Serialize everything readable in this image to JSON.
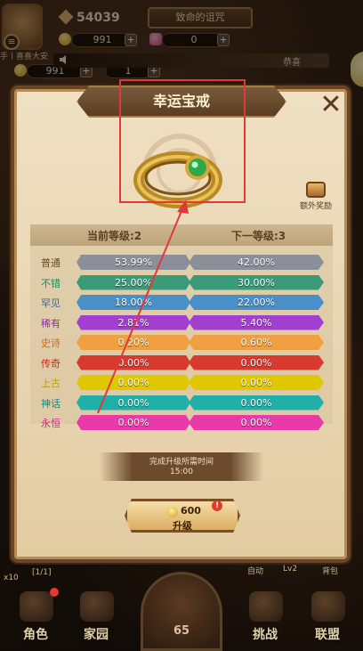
{
  "hud": {
    "power": "54039",
    "title_tab": "致命的诅咒",
    "gold": "991",
    "gem": "0",
    "gold2": "991",
    "slot": "1",
    "sub_label": "恭喜",
    "left_text": "手丨喜喜大安"
  },
  "panel": {
    "title": "幸运宝戒",
    "close_symbol": "✕",
    "extra_label": "额外奖励"
  },
  "table": {
    "current_header": "当前等级:2",
    "next_header": "下一等级:3",
    "rows": [
      {
        "label": "普通",
        "cur": "53.99%",
        "next": "42.00%",
        "label_color": "#6a4a2a",
        "color": "#8a8f98"
      },
      {
        "label": "不错",
        "cur": "25.00%",
        "next": "30.00%",
        "label_color": "#1f8a5a",
        "color": "#3b9a78"
      },
      {
        "label": "罕见",
        "cur": "18.00%",
        "next": "22.00%",
        "label_color": "#2a6aa8",
        "color": "#4a8fc8"
      },
      {
        "label": "稀有",
        "cur": "2.81%",
        "next": "5.40%",
        "label_color": "#8a2ab8",
        "color": "#a23fd0"
      },
      {
        "label": "史诗",
        "cur": "0.20%",
        "next": "0.60%",
        "label_color": "#d86a10",
        "color": "#f0a040"
      },
      {
        "label": "传奇",
        "cur": "0.00%",
        "next": "0.00%",
        "label_color": "#c8281e",
        "color": "#d83a30"
      },
      {
        "label": "上古",
        "cur": "0.00%",
        "next": "0.00%",
        "label_color": "#b8a000",
        "color": "#e0c800"
      },
      {
        "label": "神话",
        "cur": "0.00%",
        "next": "0.00%",
        "label_color": "#108a80",
        "color": "#20b0a8"
      },
      {
        "label": "永恒",
        "cur": "0.00%",
        "next": "0.00%",
        "label_color": "#d0208a",
        "color": "#e83aa8"
      }
    ]
  },
  "time": {
    "title": "完成升级所需时间",
    "value": "15:00"
  },
  "upgrade": {
    "cost": "600",
    "label": "升级",
    "alert": "!"
  },
  "bottom": {
    "auto": "自动",
    "level": "Lv2",
    "bag": "背包",
    "stage_left": "[1/1]",
    "x_label": "x10",
    "center_level": "65",
    "nav": [
      "角色",
      "家园",
      "挑战",
      "联盟"
    ]
  }
}
